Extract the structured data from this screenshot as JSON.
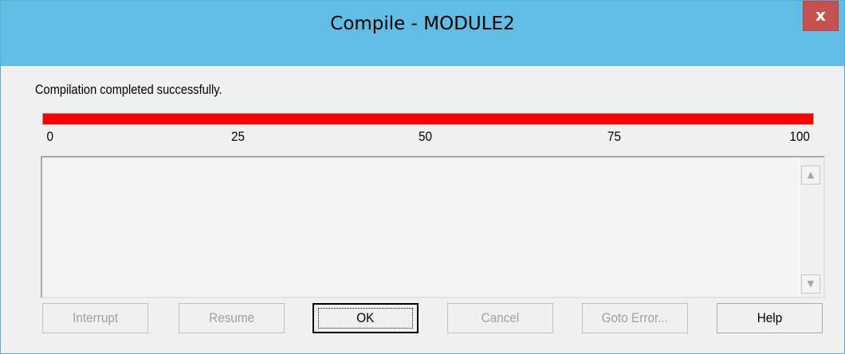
{
  "window": {
    "title": "Compile - MODULE2",
    "close_label": "x"
  },
  "status": {
    "message": "Compilation completed successfully."
  },
  "progress": {
    "percent": 100,
    "fill_color": "#ff0000",
    "ticks": [
      "0",
      "25",
      "50",
      "75",
      "100"
    ]
  },
  "output": {
    "text": ""
  },
  "buttons": {
    "interrupt": "Interrupt",
    "resume": "Resume",
    "ok": "OK",
    "cancel": "Cancel",
    "goto_error": "Goto Error...",
    "help": "Help"
  },
  "icons": {
    "scroll_up": "scroll-up-arrow-icon",
    "scroll_down": "scroll-down-arrow-icon",
    "close": "close-icon"
  }
}
